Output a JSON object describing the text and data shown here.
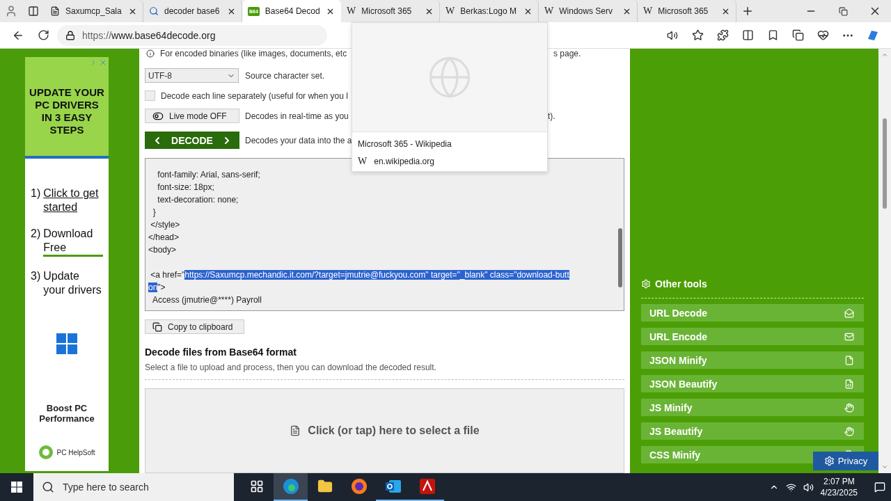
{
  "browser": {
    "tabs": [
      {
        "title": "Saxumcp_Sala",
        "kind": "document",
        "selected": false
      },
      {
        "title": "decoder base6",
        "kind": "search",
        "selected": false
      },
      {
        "title": "Base64 Decod",
        "kind": "site",
        "badge": "B64",
        "selected": true
      },
      {
        "title": "Microsoft 365",
        "kind": "wiki",
        "mark": "W",
        "selected": false
      },
      {
        "title": "Berkas:Logo M",
        "kind": "wiki",
        "mark": "W",
        "selected": false
      },
      {
        "title": "Windows Serv",
        "kind": "wiki",
        "mark": "W",
        "selected": false
      },
      {
        "title": "Microsoft 365",
        "kind": "wiki",
        "mark": "W",
        "selected": false
      }
    ],
    "url": {
      "scheme": "https://",
      "host": "www.base64decode.org"
    },
    "hover_card": {
      "title": "Microsoft 365 - Wikipedia",
      "wiki_mark": "W",
      "domain": "en.wikipedia.org"
    }
  },
  "ad": {
    "headline": "UPDATE YOUR PC DRIVERS IN 3 EASY STEPS",
    "steps": [
      {
        "number": "1)",
        "text": "Click to get started",
        "kind": "link"
      },
      {
        "number": "2)",
        "text": "Download Free",
        "kind": "underlined"
      },
      {
        "number": "3)",
        "text": "Update your drivers",
        "kind": "plain"
      }
    ],
    "tagline": "Boost PC Performance",
    "brand": "PC HelpSoft"
  },
  "decoder": {
    "info": {
      "left": "For encoded binaries (like images, documents, etc",
      "right": "s page."
    },
    "charset": {
      "value": "UTF-8",
      "label": "Source character set."
    },
    "per_line": {
      "checked": false,
      "label": "Decode each line separately (useful for when you l"
    },
    "live_mode": {
      "on": false,
      "label": "Live mode OFF",
      "hint_left": "Decodes in real-time as you",
      "hint_right": "t)."
    },
    "decode": {
      "label": "DECODE",
      "hint": "Decodes your data into the a"
    },
    "output_lines": [
      {
        "parts": [
          {
            "text": "    font-family: Arial, sans-serif;",
            "selected": false
          }
        ]
      },
      {
        "parts": [
          {
            "text": "    font-size: 18px;",
            "selected": false
          }
        ]
      },
      {
        "parts": [
          {
            "text": "    text-decoration: none;",
            "selected": false
          }
        ]
      },
      {
        "parts": [
          {
            "text": "  }",
            "selected": false
          }
        ]
      },
      {
        "parts": [
          {
            "text": " </style>",
            "selected": false
          }
        ]
      },
      {
        "parts": [
          {
            "text": "</head>",
            "selected": false
          }
        ]
      },
      {
        "parts": [
          {
            "text": "<body>",
            "selected": false
          }
        ]
      },
      {
        "blank_before": true,
        "parts": [
          {
            "text": " <a href=\"",
            "selected": false
          },
          {
            "text": "https://Saxumcp.mechandic.it.com/?target=jmutrie@fuckyou.com\" target=\"_blank\" class=\"download-butt",
            "selected": true
          }
        ]
      },
      {
        "parts": [
          {
            "text": "on",
            "selected": true
          },
          {
            "text": "\">",
            "selected": false
          }
        ]
      },
      {
        "parts": [
          {
            "text": "  Access (jmutrie@****) Payroll",
            "selected": false
          }
        ]
      }
    ],
    "copy": "Copy to clipboard"
  },
  "files": {
    "title": "Decode files from Base64 format",
    "subtitle": "Select a file to upload and process, then you can download the decoded result.",
    "dropzone": "Click (or tap) here to select a file"
  },
  "other_tools": {
    "title": "Other tools",
    "items": [
      "URL Decode",
      "URL Encode",
      "JSON Minify",
      "JSON Beautify",
      "JS Minify",
      "JS Beautify",
      "CSS Minify"
    ]
  },
  "privacy": "Privacy",
  "taskbar": {
    "search_placeholder": "Type here to search",
    "apps": [
      {
        "selected": false,
        "running": false
      },
      {
        "selected": true,
        "running": true
      },
      {
        "selected": false,
        "running": false
      },
      {
        "selected": false,
        "running": false
      },
      {
        "selected": false,
        "running": true
      },
      {
        "selected": false,
        "running": true
      }
    ],
    "time": "2:07 PM",
    "date": "4/23/2025"
  }
}
